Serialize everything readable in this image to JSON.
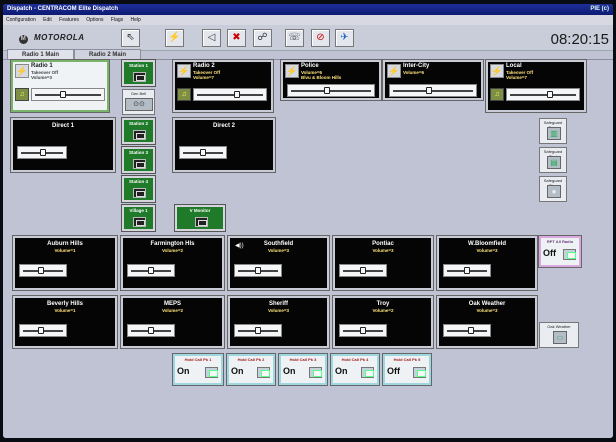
{
  "window": {
    "title": "Dispatch - CENTRACOM Elite Dispatch",
    "right_text": "PIE (c)",
    "menu": [
      "Configuration",
      "Edit",
      "Features",
      "Options",
      "Flags",
      "Help"
    ]
  },
  "toolbar": {
    "logo_text": "MOTOROLA",
    "logo_mark": "M",
    "clock": "08:20:15",
    "buttons": [
      {
        "icon": "select-icon",
        "glyph": "⇖"
      },
      {
        "icon": "transmit-icon",
        "glyph": "⚡"
      },
      {
        "icon": "speaker-icon",
        "glyph": "◁"
      },
      {
        "icon": "mute-icon",
        "glyph": "✖"
      },
      {
        "icon": "patch-icon",
        "glyph": "☍"
      },
      {
        "icon": "phone-icon",
        "glyph": "☏"
      },
      {
        "icon": "disable-icon",
        "glyph": "⊘"
      },
      {
        "icon": "tools-icon",
        "glyph": "✈"
      }
    ]
  },
  "tabs": [
    {
      "label": "Radio 1 Main",
      "active": true
    },
    {
      "label": "Radio 2 Main",
      "active": false
    }
  ],
  "top_radios": [
    {
      "name": "Radio 1",
      "line1": "Takeover Off",
      "line2": "Volume=3",
      "selected": true
    },
    {
      "name": "Radio 2",
      "line1": "Takeover Off",
      "line2": "Volume=7",
      "selected": false
    },
    {
      "name": "Police",
      "line1": "Volume=6",
      "line2": "Blvu & Bloom Hills",
      "selected": false
    },
    {
      "name": "Inter-City",
      "line1": "Volume=6",
      "line2": "",
      "selected": false
    },
    {
      "name": "Local",
      "line1": "Takeover Off",
      "line2": "Volume=7",
      "selected": false
    }
  ],
  "direct": [
    {
      "name": "Direct 1"
    },
    {
      "name": "Direct 2"
    }
  ],
  "stations": [
    "Station 1",
    "Station 2",
    "Station 3",
    "Station 4",
    "Village 1",
    "V Monitor"
  ],
  "gen_bell": "Gen Bell",
  "row3": [
    {
      "name": "Auburn Hills",
      "status": "Volume=1"
    },
    {
      "name": "Farmington Hls",
      "status": "Volume=2"
    },
    {
      "name": "Southfield",
      "status": "Volume=3"
    },
    {
      "name": "Pontiac",
      "status": "Volume=3"
    },
    {
      "name": "W.Bloomfield",
      "status": "Volume=3"
    }
  ],
  "row4": [
    {
      "name": "Beverly Hills",
      "status": "Volume=1"
    },
    {
      "name": "MEPS",
      "status": "Volume=2"
    },
    {
      "name": "Sheriff",
      "status": "Volume=3"
    },
    {
      "name": "Troy",
      "status": "Volume=2"
    },
    {
      "name": "Oak Weather",
      "status": "Volume=3"
    }
  ],
  "side_panels": [
    {
      "label": "Safeguard Open",
      "glyph": "▥"
    },
    {
      "label": "Safeguard Shut",
      "glyph": "▤"
    },
    {
      "label": "Safeguard Stop",
      "glyph": "●"
    }
  ],
  "aux_radio": {
    "label": "RPT All Radio",
    "state": "Off"
  },
  "oak_weather_btn": "Oak Weather",
  "patches": [
    {
      "label": "Hold Call Pk 1",
      "state": "On"
    },
    {
      "label": "Hold Call Pk 2",
      "state": "On"
    },
    {
      "label": "Hold Call Pk 3",
      "state": "On"
    },
    {
      "label": "Hold Call Pk 4",
      "state": "On"
    },
    {
      "label": "Hold Call Pk 5",
      "state": "Off"
    }
  ],
  "colors": {
    "accent": "#1f2f9a",
    "station_green": "#1f7a2a",
    "console_bg": "#bfc3d3"
  }
}
